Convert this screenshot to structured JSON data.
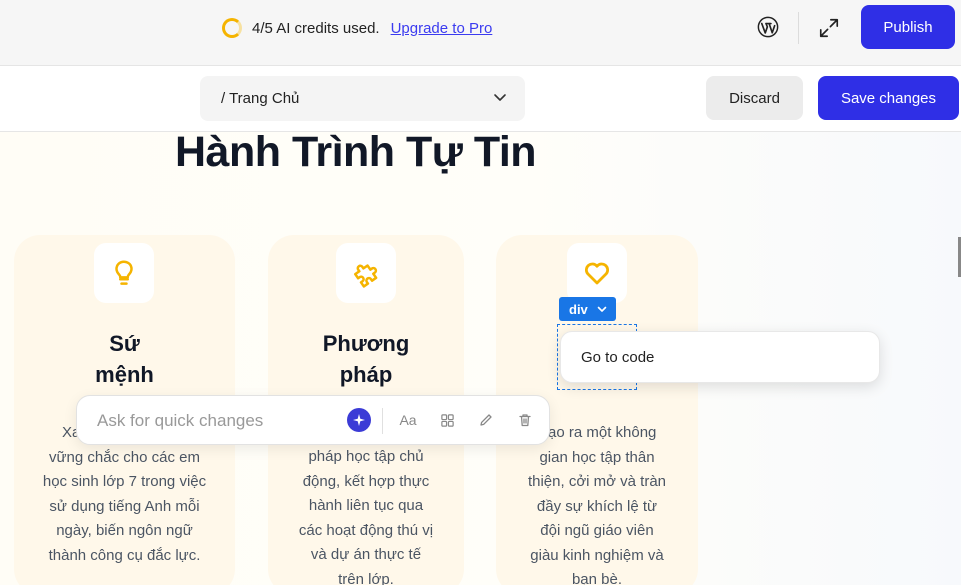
{
  "topbar": {
    "credits_text": "4/5 AI credits used.",
    "upgrade_link": "Upgrade to Pro",
    "publish_label": "Publish",
    "icons": [
      "loading-ring-icon",
      "wordpress-icon",
      "expand-icon"
    ]
  },
  "pagebar": {
    "page_select_value": "/ Trang Chủ",
    "discard_label": "Discard",
    "save_label": "Save changes"
  },
  "content": {
    "title": "Hành Trình Tự Tin",
    "cards": [
      {
        "icon": "lightbulb-icon",
        "heading_lines": [
          "Sứ",
          "mệnh"
        ],
        "body_lines": [
          "Xa",
          "vững chắc cho các em",
          "học sinh lớp 7 trong việc",
          "sử dụng tiếng Anh mỗi",
          "ngày, biến ngôn ngữ",
          "thành công cụ đắc lực."
        ]
      },
      {
        "icon": "puzzle-icon",
        "heading_lines": [
          "Phương",
          "pháp"
        ],
        "body_lines": [
          "pháp học tập chủ",
          "động, kết hợp thực",
          "hành liên tục qua",
          "các hoạt động thú vị",
          "và dự án thực tế",
          "trên lớp."
        ]
      },
      {
        "icon": "heart-icon",
        "body_lines": [
          "ạo ra một không",
          "gian học tập thân",
          "thiện, cởi mở và tràn",
          "đầy sự khích lệ từ",
          "đội ngũ giáo viên",
          "giàu kinh nghiệm và",
          "bạn bè."
        ]
      }
    ]
  },
  "editor": {
    "selection_tag": "div",
    "context_menu_item": "Go to code",
    "quick_placeholder": "Ask for quick changes",
    "text_tool_label": "Aa"
  },
  "colors": {
    "primary": "#2f2fe6",
    "accent_yellow": "#f5b400",
    "selection_blue": "#1976e6",
    "card_bg": "#fff8ea"
  }
}
